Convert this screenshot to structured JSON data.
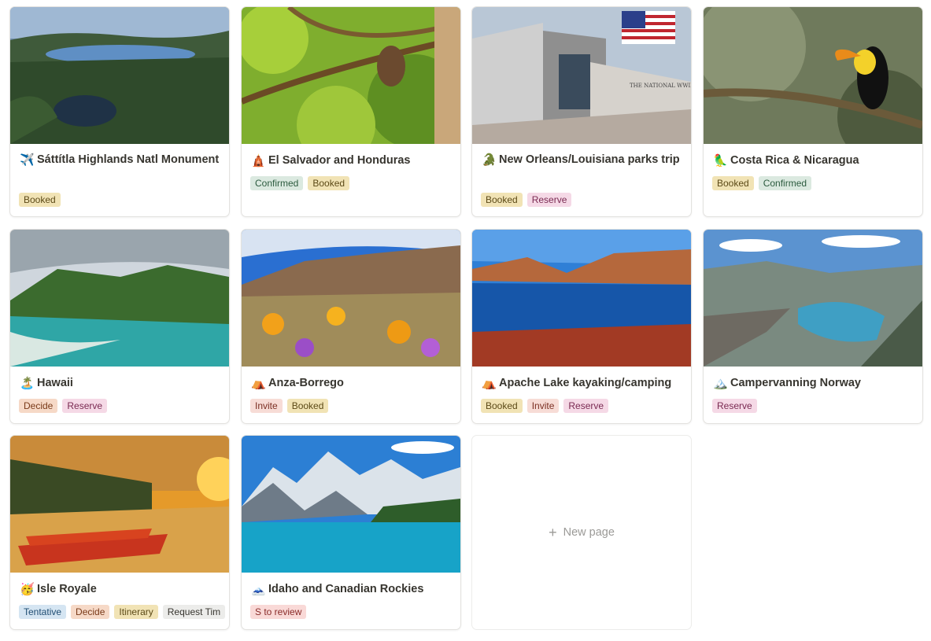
{
  "cards": [
    {
      "emoji": "✈️",
      "title": "Sáttítla Highlands Natl Monument",
      "tags": [
        "Booked"
      ]
    },
    {
      "emoji": "🛕",
      "title": "El Salvador and Honduras",
      "tags": [
        "Confirmed",
        "Booked"
      ]
    },
    {
      "emoji": "🐊",
      "title": "New Orleans/Louisiana parks trip",
      "tags": [
        "Booked",
        "Reserve"
      ]
    },
    {
      "emoji": "🦜",
      "title": "Costa Rica & Nicaragua",
      "tags": [
        "Booked",
        "Confirmed"
      ]
    },
    {
      "emoji": "🏝️",
      "title": "Hawaii",
      "tags": [
        "Decide",
        "Reserve"
      ]
    },
    {
      "emoji": "⛺",
      "title": "Anza-Borrego",
      "tags": [
        "Invite",
        "Booked"
      ]
    },
    {
      "emoji": "⛺",
      "title": "Apache Lake kayaking/camping",
      "tags": [
        "Booked",
        "Invite",
        "Reserve"
      ]
    },
    {
      "emoji": "🏔️",
      "title": "Campervanning Norway",
      "tags": [
        "Reserve"
      ]
    },
    {
      "emoji": "🥳",
      "title": "Isle Royale",
      "tags": [
        "Tentative",
        "Decide",
        "Itinerary",
        "Request Tim"
      ]
    },
    {
      "emoji": "🗻",
      "title": "Idaho and Canadian Rockies",
      "tags": [
        "S to review"
      ]
    }
  ],
  "new_page": {
    "plus": "+",
    "label": "New page"
  },
  "cover_text": {
    "museum_sign": "THE NATIONAL WWII"
  }
}
